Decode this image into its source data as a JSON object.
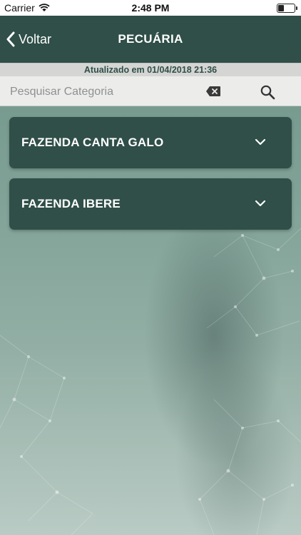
{
  "status_bar": {
    "carrier": "Carrier",
    "time": "2:48 PM",
    "icons": [
      "wifi-icon",
      "battery-icon"
    ]
  },
  "nav": {
    "back_label": "Voltar",
    "title": "PECUÁRIA",
    "back_icon": "chevron-left-icon"
  },
  "updated_text": "Atualizado em 01/04/2018 21:36",
  "search": {
    "placeholder": "Pesquisar Categoria",
    "value": "",
    "clear_icon": "clear-icon",
    "search_icon": "search-icon"
  },
  "farms": [
    {
      "label": "FAZENDA CANTA GALO",
      "icon": "chevron-down-icon"
    },
    {
      "label": "FAZENDA IBERE",
      "icon": "chevron-down-icon"
    }
  ],
  "colors": {
    "nav_background": "#2f4f48",
    "card_background": "#2f4f48",
    "updated_text": "#2f4f48",
    "updated_background": "#d5d5d3",
    "search_background": "#ececeb"
  }
}
